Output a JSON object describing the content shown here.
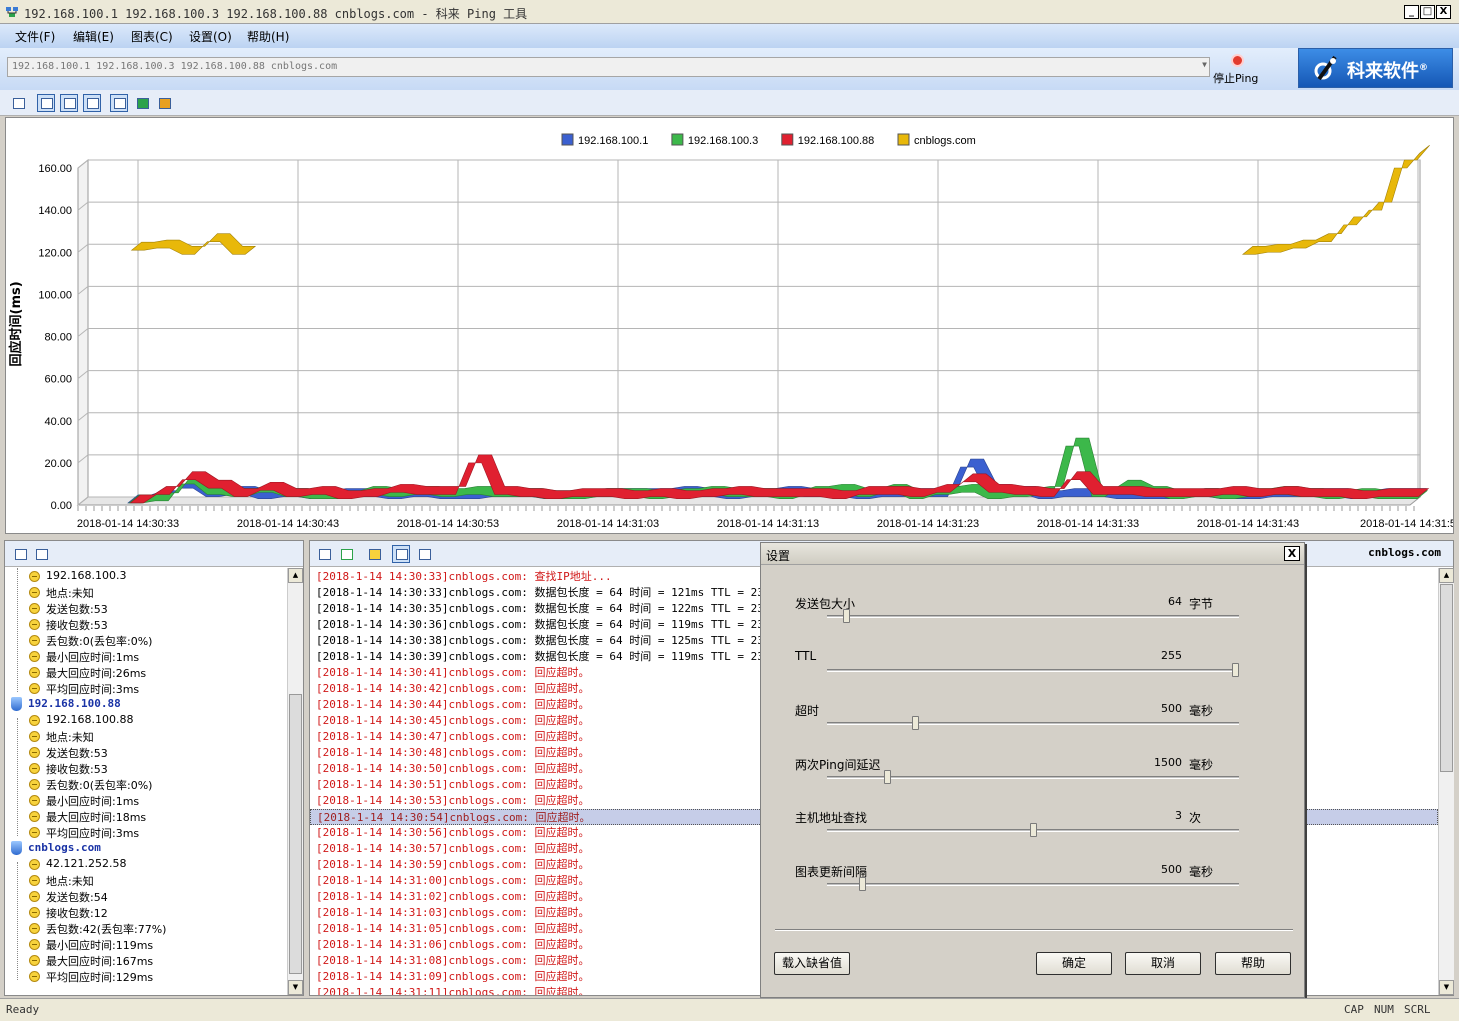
{
  "window": {
    "title": "192.168.100.1 192.168.100.3 192.168.100.88 cnblogs.com - 科来 Ping 工具",
    "min": "_",
    "max": "□",
    "close": "X"
  },
  "menu": [
    "文件(F)",
    "编辑(E)",
    "图表(C)",
    "设置(O)",
    "帮助(H)"
  ],
  "address": {
    "value": "192.168.100.1 192.168.100.3 192.168.100.88 cnblogs.com",
    "stop_label": "停止Ping"
  },
  "brand": {
    "name": "科来软件",
    "reg": "®"
  },
  "chart_data": {
    "type": "area",
    "ylabel": "回应时间(ms)",
    "ylim": [
      0,
      160
    ],
    "yticks": [
      "0.00",
      "20.00",
      "40.00",
      "60.00",
      "80.00",
      "100.00",
      "120.00",
      "140.00",
      "160.00"
    ],
    "x_ticks": [
      "2018-01-14 14:30:33",
      "2018-01-14 14:30:43",
      "2018-01-14 14:30:53",
      "2018-01-14 14:31:03",
      "2018-01-14 14:31:13",
      "2018-01-14 14:31:23",
      "2018-01-14 14:31:33",
      "2018-01-14 14:31:43",
      "2018-01-14 14:31:5"
    ],
    "legend_position": "top-center",
    "series": [
      {
        "name": "192.168.100.1",
        "color": "#3b60d0",
        "values": [
          1,
          1,
          3,
          3,
          8,
          8,
          4,
          4,
          5,
          5,
          3,
          3,
          4,
          4,
          3,
          3,
          4,
          4,
          4,
          4,
          3,
          3,
          4,
          4,
          3,
          3,
          3,
          3,
          4,
          4,
          4,
          4,
          3,
          3,
          3,
          3,
          4,
          4,
          4,
          4,
          4,
          4,
          5,
          5,
          4,
          4,
          3,
          3,
          4,
          4,
          5,
          5,
          4,
          4,
          4,
          4,
          3,
          3,
          4,
          4,
          4,
          4,
          4,
          4,
          18,
          18,
          6,
          6,
          5,
          5,
          3,
          3,
          4,
          4,
          4,
          4,
          3,
          3,
          3,
          3,
          3,
          3,
          4,
          4,
          3,
          3,
          3,
          3,
          4,
          4,
          4,
          4,
          4,
          4,
          3,
          3,
          4,
          4,
          4,
          4
        ]
      },
      {
        "name": "192.168.100.3",
        "color": "#3cb84a",
        "values": [
          1,
          1,
          2,
          2,
          10,
          10,
          5,
          5,
          4,
          4,
          6,
          6,
          4,
          4,
          3,
          3,
          3,
          3,
          5,
          5,
          4,
          4,
          5,
          5,
          4,
          4,
          5,
          5,
          4,
          4,
          4,
          4,
          3,
          3,
          3,
          3,
          4,
          4,
          4,
          4,
          3,
          3,
          4,
          4,
          5,
          5,
          4,
          4,
          4,
          4,
          3,
          3,
          5,
          5,
          6,
          6,
          4,
          4,
          6,
          6,
          3,
          3,
          5,
          5,
          6,
          6,
          3,
          3,
          4,
          4,
          5,
          5,
          28,
          28,
          4,
          4,
          8,
          8,
          5,
          5,
          3,
          3,
          4,
          4,
          3,
          3,
          4,
          4,
          5,
          5,
          4,
          4,
          3,
          3,
          4,
          4,
          3,
          3,
          3,
          3
        ]
      },
      {
        "name": "192.168.100.88",
        "color": "#e02030",
        "values": [
          1,
          1,
          5,
          5,
          12,
          12,
          8,
          8,
          4,
          4,
          7,
          7,
          4,
          4,
          5,
          5,
          3,
          3,
          4,
          4,
          6,
          6,
          5,
          5,
          5,
          5,
          20,
          20,
          5,
          5,
          4,
          4,
          3,
          3,
          4,
          4,
          4,
          4,
          3,
          3,
          4,
          4,
          3,
          3,
          4,
          4,
          5,
          5,
          4,
          4,
          4,
          4,
          4,
          4,
          3,
          3,
          5,
          5,
          5,
          5,
          4,
          4,
          6,
          6,
          11,
          11,
          6,
          6,
          5,
          5,
          4,
          4,
          12,
          12,
          5,
          5,
          5,
          5,
          4,
          4,
          4,
          4,
          4,
          4,
          5,
          5,
          4,
          4,
          5,
          5,
          4,
          4,
          4,
          4,
          3,
          3,
          4,
          4,
          4,
          4
        ]
      },
      {
        "name": "cnblogs.com",
        "color": "#e8b80a",
        "values": [
          121,
          121,
          122,
          122,
          119,
          119,
          125,
          125,
          119,
          119,
          null,
          null,
          null,
          null,
          null,
          null,
          null,
          null,
          null,
          null,
          null,
          null,
          null,
          null,
          null,
          null,
          null,
          null,
          null,
          null,
          null,
          null,
          null,
          null,
          null,
          null,
          null,
          null,
          null,
          null,
          null,
          null,
          null,
          null,
          null,
          null,
          null,
          null,
          null,
          null,
          null,
          null,
          null,
          null,
          null,
          null,
          null,
          null,
          null,
          null,
          null,
          null,
          null,
          null,
          null,
          null,
          null,
          null,
          null,
          null,
          null,
          null,
          null,
          null,
          null,
          null,
          null,
          null,
          null,
          null,
          null,
          null,
          null,
          null,
          null,
          null,
          null,
          null,
          119,
          119,
          120,
          120,
          122,
          122,
          125,
          125,
          133,
          133,
          140,
          140,
          160,
          160,
          167
        ]
      }
    ]
  },
  "tree": [
    {
      "kind": "item",
      "text": "192.168.100.3",
      "indent": 1
    },
    {
      "kind": "item",
      "text": "地点:未知",
      "indent": 1
    },
    {
      "kind": "item",
      "text": "发送包数:53",
      "indent": 1
    },
    {
      "kind": "item",
      "text": "接收包数:53",
      "indent": 1
    },
    {
      "kind": "item",
      "text": "丢包数:0(丢包率:0%)",
      "indent": 1
    },
    {
      "kind": "item",
      "text": "最小回应时间:1ms",
      "indent": 1
    },
    {
      "kind": "item",
      "text": "最大回应时间:26ms",
      "indent": 1
    },
    {
      "kind": "item",
      "text": "平均回应时间:3ms",
      "indent": 1
    },
    {
      "kind": "host",
      "text": "192.168.100.88",
      "indent": 0
    },
    {
      "kind": "item",
      "text": "192.168.100.88",
      "indent": 1
    },
    {
      "kind": "item",
      "text": "地点:未知",
      "indent": 1
    },
    {
      "kind": "item",
      "text": "发送包数:53",
      "indent": 1
    },
    {
      "kind": "item",
      "text": "接收包数:53",
      "indent": 1
    },
    {
      "kind": "item",
      "text": "丢包数:0(丢包率:0%)",
      "indent": 1
    },
    {
      "kind": "item",
      "text": "最小回应时间:1ms",
      "indent": 1
    },
    {
      "kind": "item",
      "text": "最大回应时间:18ms",
      "indent": 1
    },
    {
      "kind": "item",
      "text": "平均回应时间:3ms",
      "indent": 1
    },
    {
      "kind": "host",
      "text": "cnblogs.com",
      "indent": 0
    },
    {
      "kind": "item",
      "text": "42.121.252.58",
      "indent": 1
    },
    {
      "kind": "item",
      "text": "地点:未知",
      "indent": 1
    },
    {
      "kind": "item",
      "text": "发送包数:54",
      "indent": 1
    },
    {
      "kind": "item",
      "text": "接收包数:12",
      "indent": 1
    },
    {
      "kind": "item",
      "text": "丢包数:42(丢包率:77%)",
      "indent": 1
    },
    {
      "kind": "item",
      "text": "最小回应时间:119ms",
      "indent": 1
    },
    {
      "kind": "item",
      "text": "最大回应时间:167ms",
      "indent": 1
    },
    {
      "kind": "item",
      "text": "平均回应时间:129ms",
      "indent": 1
    }
  ],
  "log_host": "cnblogs.com",
  "log": [
    {
      "text": "[2018-1-14 14:30:33]cnblogs.com: 查找IP地址...",
      "red": true
    },
    {
      "text": "[2018-1-14 14:30:33]cnblogs.com: 数据包长度 = 64 时间 = 121ms TTL = 231",
      "red": false
    },
    {
      "text": "[2018-1-14 14:30:35]cnblogs.com: 数据包长度 = 64 时间 = 122ms TTL = 231",
      "red": false
    },
    {
      "text": "[2018-1-14 14:30:36]cnblogs.com: 数据包长度 = 64 时间 = 119ms TTL = 231",
      "red": false
    },
    {
      "text": "[2018-1-14 14:30:38]cnblogs.com: 数据包长度 = 64 时间 = 125ms TTL = 231",
      "red": false
    },
    {
      "text": "[2018-1-14 14:30:39]cnblogs.com: 数据包长度 = 64 时间 = 119ms TTL = 231",
      "red": false
    },
    {
      "text": "[2018-1-14 14:30:41]cnblogs.com: 回应超时。",
      "red": true
    },
    {
      "text": "[2018-1-14 14:30:42]cnblogs.com: 回应超时。",
      "red": true
    },
    {
      "text": "[2018-1-14 14:30:44]cnblogs.com: 回应超时。",
      "red": true
    },
    {
      "text": "[2018-1-14 14:30:45]cnblogs.com: 回应超时。",
      "red": true
    },
    {
      "text": "[2018-1-14 14:30:47]cnblogs.com: 回应超时。",
      "red": true
    },
    {
      "text": "[2018-1-14 14:30:48]cnblogs.com: 回应超时。",
      "red": true
    },
    {
      "text": "[2018-1-14 14:30:50]cnblogs.com: 回应超时。",
      "red": true
    },
    {
      "text": "[2018-1-14 14:30:51]cnblogs.com: 回应超时。",
      "red": true
    },
    {
      "text": "[2018-1-14 14:30:53]cnblogs.com: 回应超时。",
      "red": true
    },
    {
      "text": "[2018-1-14 14:30:54]cnblogs.com: 回应超时。",
      "red": true,
      "selected": true
    },
    {
      "text": "[2018-1-14 14:30:56]cnblogs.com: 回应超时。",
      "red": true
    },
    {
      "text": "[2018-1-14 14:30:57]cnblogs.com: 回应超时。",
      "red": true
    },
    {
      "text": "[2018-1-14 14:30:59]cnblogs.com: 回应超时。",
      "red": true
    },
    {
      "text": "[2018-1-14 14:31:00]cnblogs.com: 回应超时。",
      "red": true
    },
    {
      "text": "[2018-1-14 14:31:02]cnblogs.com: 回应超时。",
      "red": true
    },
    {
      "text": "[2018-1-14 14:31:03]cnblogs.com: 回应超时。",
      "red": true
    },
    {
      "text": "[2018-1-14 14:31:05]cnblogs.com: 回应超时。",
      "red": true
    },
    {
      "text": "[2018-1-14 14:31:06]cnblogs.com: 回应超时。",
      "red": true
    },
    {
      "text": "[2018-1-14 14:31:08]cnblogs.com: 回应超时。",
      "red": true
    },
    {
      "text": "[2018-1-14 14:31:09]cnblogs.com: 回应超时。",
      "red": true
    },
    {
      "text": "[2018-1-14 14:31:11]cnblogs.com: 回应超时。",
      "red": true
    }
  ],
  "settings_dialog": {
    "title": "设置",
    "close": "X",
    "items": [
      {
        "label": "发送包大小",
        "value": "64",
        "unit": "字节",
        "slider_fraction": 0.04
      },
      {
        "label": "TTL",
        "value": "255",
        "unit": "",
        "slider_fraction": 1.0
      },
      {
        "label": "超时",
        "value": "500",
        "unit": "毫秒",
        "slider_fraction": 0.21
      },
      {
        "label": "两次Ping间延迟",
        "value": "1500",
        "unit": "毫秒",
        "slider_fraction": 0.14
      },
      {
        "label": "主机地址查找",
        "value": "3",
        "unit": "次",
        "slider_fraction": 0.5
      },
      {
        "label": "图表更新间隔",
        "value": "500",
        "unit": "毫秒",
        "slider_fraction": 0.08
      }
    ],
    "buttons": {
      "defaults": "载入缺省值",
      "ok": "确定",
      "cancel": "取消",
      "help": "帮助"
    }
  },
  "status": {
    "ready": "Ready",
    "cap": "CAP",
    "num": "NUM",
    "scrl": "SCRL"
  }
}
